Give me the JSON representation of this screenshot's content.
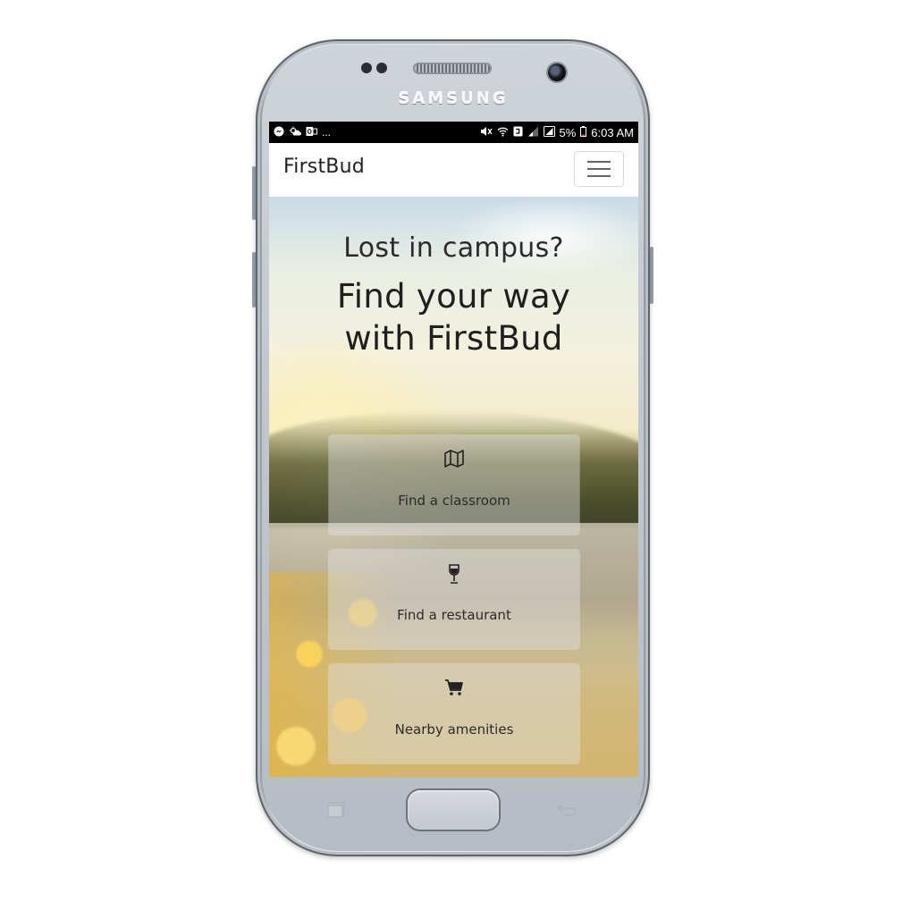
{
  "device": {
    "brand_text": "SAMSUNG"
  },
  "status_bar": {
    "left_icons": [
      "messenger-icon",
      "weather-icon",
      "outlook-icon"
    ],
    "overflow": "...",
    "battery_percent": "5%",
    "time": "6:03 AM"
  },
  "navbar": {
    "brand": "FirstBud",
    "menu_icon": "hamburger-icon"
  },
  "hero": {
    "question": "Lost in campus?",
    "tagline_line1": "Find your way",
    "tagline_line2": "with FirstBud"
  },
  "features": [
    {
      "icon": "map-icon",
      "label": "Find a classroom"
    },
    {
      "icon": "wine-glass-icon",
      "label": "Find a restaurant"
    },
    {
      "icon": "shopping-cart-icon",
      "label": "Nearby amenities"
    }
  ]
}
